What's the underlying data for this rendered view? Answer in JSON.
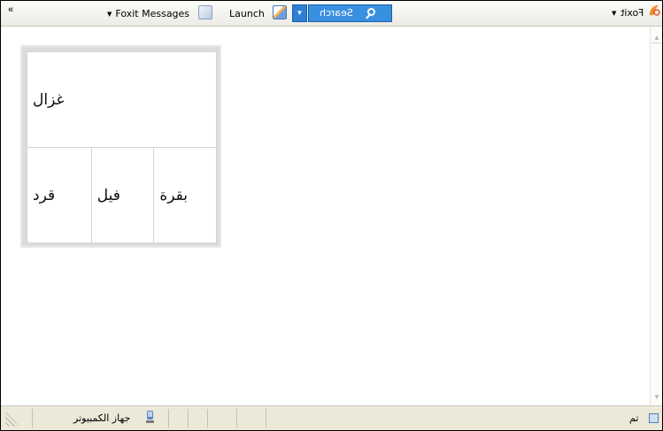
{
  "toolbar": {
    "chevron": "«",
    "foxit_messages_label": "Foxit Messages",
    "launch_label": "Launch",
    "search_label": "Search",
    "foxit_label": "Foxit"
  },
  "table": {
    "top_cell": "غزال",
    "bottom_cells": [
      "بقرة",
      "فيل",
      "قرد"
    ]
  },
  "statusbar": {
    "done_text": "تم",
    "zone_text": "جهاز الكمبيوتر"
  },
  "colors": {
    "search_accent": "#3a90e0",
    "statusbar_bg": "#ece9d8"
  }
}
